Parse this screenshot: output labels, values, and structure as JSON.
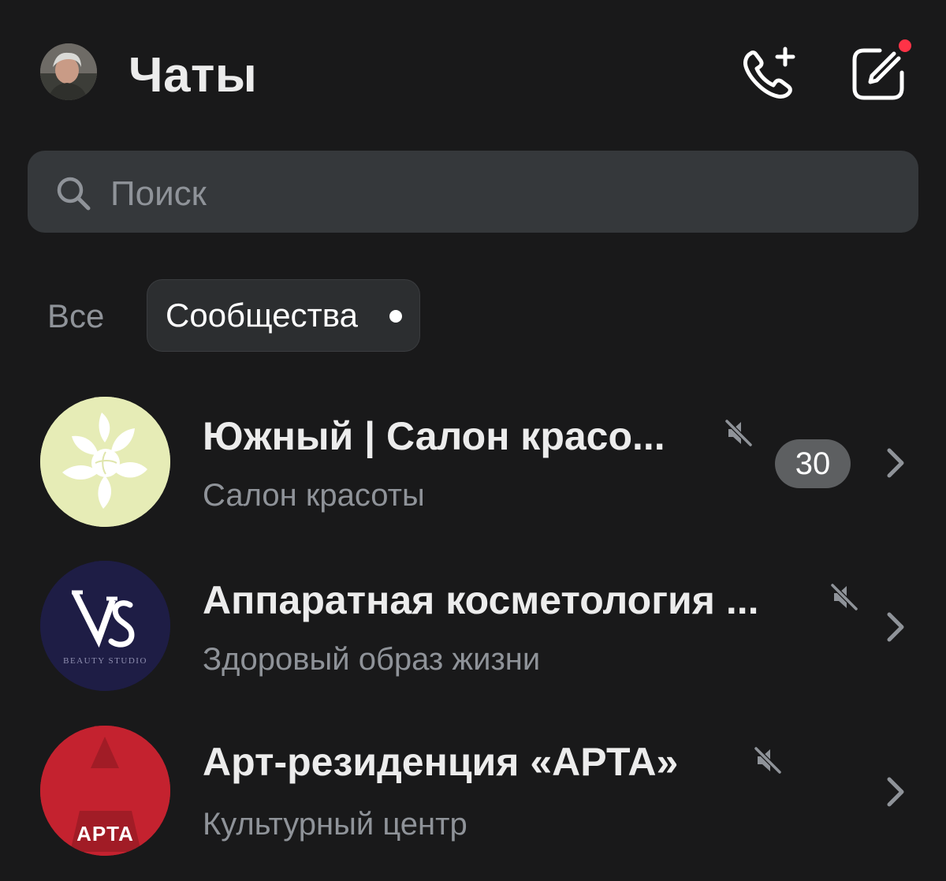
{
  "header": {
    "title": "Чаты",
    "call_button_icon": "phone-plus-icon",
    "compose_button_icon": "compose-icon",
    "has_notification": true
  },
  "search": {
    "placeholder": "Поиск",
    "value": ""
  },
  "tabs": [
    {
      "label": "Все",
      "selected": false
    },
    {
      "label": "Сообщества",
      "selected": true,
      "has_unread_dot": true
    }
  ],
  "chats": [
    {
      "title": "Южный | Салон красо...",
      "subtitle": "Салон красоты",
      "muted": true,
      "unread_count": "30",
      "avatar_color": "#e6ecb6"
    },
    {
      "title": "Аппаратная косметология ...",
      "subtitle": "Здоровый образ жизни",
      "muted": true,
      "avatar_color": "#1e1d45",
      "avatar_logo_text": "BEAUTY STUDIO"
    },
    {
      "title": "Арт-резиденция «АРТА»",
      "subtitle": "Культурный центр",
      "muted": true,
      "avatar_color": "#c4222f",
      "avatar_logo_text": "APTA"
    }
  ],
  "colors": {
    "background": "#19191a",
    "search_bg": "#35383b",
    "badge_bg": "#5d5f61",
    "notification": "#ff3347",
    "secondary_text": "#8f9399"
  }
}
